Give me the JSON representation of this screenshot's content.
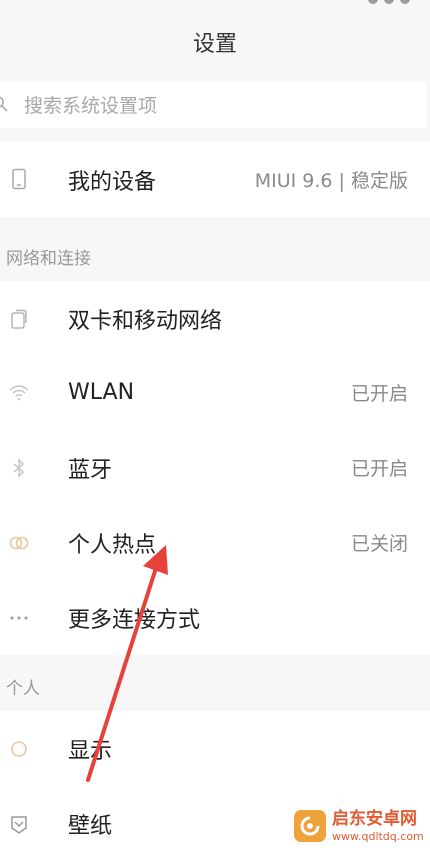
{
  "header": {
    "title": "设置"
  },
  "search": {
    "placeholder": "搜索系统设置项"
  },
  "device": {
    "label": "我的设备",
    "value": "MIUI 9.6 | 稳定版"
  },
  "sections": {
    "network": {
      "title": "网络和连接",
      "items": [
        {
          "label": "双卡和移动网络",
          "value": "",
          "icon": "sim-card-icon"
        },
        {
          "label": "WLAN",
          "value": "已开启",
          "icon": "wifi-icon"
        },
        {
          "label": "蓝牙",
          "value": "已开启",
          "icon": "bluetooth-icon"
        },
        {
          "label": "个人热点",
          "value": "已关闭",
          "icon": "hotspot-icon"
        },
        {
          "label": "更多连接方式",
          "value": "",
          "icon": "more-dots-icon"
        }
      ]
    },
    "personal": {
      "title": "个人",
      "items": [
        {
          "label": "显示",
          "value": "",
          "icon": "display-icon"
        },
        {
          "label": "壁纸",
          "value": "",
          "icon": "wallpaper-icon"
        }
      ]
    }
  },
  "watermark": {
    "title": "启东安卓网",
    "url": "www.qdltdq.com"
  },
  "colors": {
    "annotation_arrow": "#e8413a",
    "icon": "#b5b5b5",
    "watermark": "#e25b32"
  }
}
